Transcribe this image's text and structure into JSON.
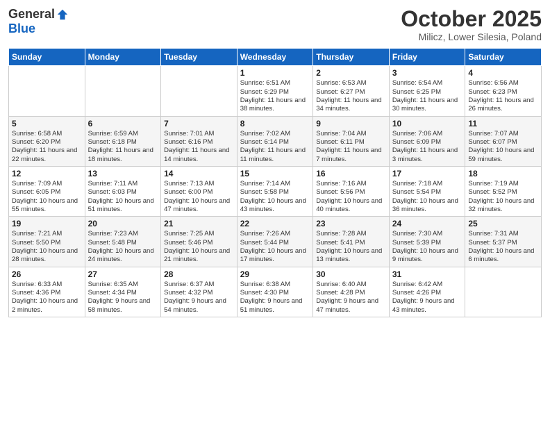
{
  "header": {
    "logo_general": "General",
    "logo_blue": "Blue",
    "month_title": "October 2025",
    "subtitle": "Milicz, Lower Silesia, Poland"
  },
  "days_of_week": [
    "Sunday",
    "Monday",
    "Tuesday",
    "Wednesday",
    "Thursday",
    "Friday",
    "Saturday"
  ],
  "weeks": [
    [
      {
        "day": "",
        "detail": ""
      },
      {
        "day": "",
        "detail": ""
      },
      {
        "day": "",
        "detail": ""
      },
      {
        "day": "1",
        "detail": "Sunrise: 6:51 AM\nSunset: 6:29 PM\nDaylight: 11 hours\nand 38 minutes."
      },
      {
        "day": "2",
        "detail": "Sunrise: 6:53 AM\nSunset: 6:27 PM\nDaylight: 11 hours\nand 34 minutes."
      },
      {
        "day": "3",
        "detail": "Sunrise: 6:54 AM\nSunset: 6:25 PM\nDaylight: 11 hours\nand 30 minutes."
      },
      {
        "day": "4",
        "detail": "Sunrise: 6:56 AM\nSunset: 6:23 PM\nDaylight: 11 hours\nand 26 minutes."
      }
    ],
    [
      {
        "day": "5",
        "detail": "Sunrise: 6:58 AM\nSunset: 6:20 PM\nDaylight: 11 hours\nand 22 minutes."
      },
      {
        "day": "6",
        "detail": "Sunrise: 6:59 AM\nSunset: 6:18 PM\nDaylight: 11 hours\nand 18 minutes."
      },
      {
        "day": "7",
        "detail": "Sunrise: 7:01 AM\nSunset: 6:16 PM\nDaylight: 11 hours\nand 14 minutes."
      },
      {
        "day": "8",
        "detail": "Sunrise: 7:02 AM\nSunset: 6:14 PM\nDaylight: 11 hours\nand 11 minutes."
      },
      {
        "day": "9",
        "detail": "Sunrise: 7:04 AM\nSunset: 6:11 PM\nDaylight: 11 hours\nand 7 minutes."
      },
      {
        "day": "10",
        "detail": "Sunrise: 7:06 AM\nSunset: 6:09 PM\nDaylight: 11 hours\nand 3 minutes."
      },
      {
        "day": "11",
        "detail": "Sunrise: 7:07 AM\nSunset: 6:07 PM\nDaylight: 10 hours\nand 59 minutes."
      }
    ],
    [
      {
        "day": "12",
        "detail": "Sunrise: 7:09 AM\nSunset: 6:05 PM\nDaylight: 10 hours\nand 55 minutes."
      },
      {
        "day": "13",
        "detail": "Sunrise: 7:11 AM\nSunset: 6:03 PM\nDaylight: 10 hours\nand 51 minutes."
      },
      {
        "day": "14",
        "detail": "Sunrise: 7:13 AM\nSunset: 6:00 PM\nDaylight: 10 hours\nand 47 minutes."
      },
      {
        "day": "15",
        "detail": "Sunrise: 7:14 AM\nSunset: 5:58 PM\nDaylight: 10 hours\nand 43 minutes."
      },
      {
        "day": "16",
        "detail": "Sunrise: 7:16 AM\nSunset: 5:56 PM\nDaylight: 10 hours\nand 40 minutes."
      },
      {
        "day": "17",
        "detail": "Sunrise: 7:18 AM\nSunset: 5:54 PM\nDaylight: 10 hours\nand 36 minutes."
      },
      {
        "day": "18",
        "detail": "Sunrise: 7:19 AM\nSunset: 5:52 PM\nDaylight: 10 hours\nand 32 minutes."
      }
    ],
    [
      {
        "day": "19",
        "detail": "Sunrise: 7:21 AM\nSunset: 5:50 PM\nDaylight: 10 hours\nand 28 minutes."
      },
      {
        "day": "20",
        "detail": "Sunrise: 7:23 AM\nSunset: 5:48 PM\nDaylight: 10 hours\nand 24 minutes."
      },
      {
        "day": "21",
        "detail": "Sunrise: 7:25 AM\nSunset: 5:46 PM\nDaylight: 10 hours\nand 21 minutes."
      },
      {
        "day": "22",
        "detail": "Sunrise: 7:26 AM\nSunset: 5:44 PM\nDaylight: 10 hours\nand 17 minutes."
      },
      {
        "day": "23",
        "detail": "Sunrise: 7:28 AM\nSunset: 5:41 PM\nDaylight: 10 hours\nand 13 minutes."
      },
      {
        "day": "24",
        "detail": "Sunrise: 7:30 AM\nSunset: 5:39 PM\nDaylight: 10 hours\nand 9 minutes."
      },
      {
        "day": "25",
        "detail": "Sunrise: 7:31 AM\nSunset: 5:37 PM\nDaylight: 10 hours\nand 6 minutes."
      }
    ],
    [
      {
        "day": "26",
        "detail": "Sunrise: 6:33 AM\nSunset: 4:36 PM\nDaylight: 10 hours\nand 2 minutes."
      },
      {
        "day": "27",
        "detail": "Sunrise: 6:35 AM\nSunset: 4:34 PM\nDaylight: 9 hours\nand 58 minutes."
      },
      {
        "day": "28",
        "detail": "Sunrise: 6:37 AM\nSunset: 4:32 PM\nDaylight: 9 hours\nand 54 minutes."
      },
      {
        "day": "29",
        "detail": "Sunrise: 6:38 AM\nSunset: 4:30 PM\nDaylight: 9 hours\nand 51 minutes."
      },
      {
        "day": "30",
        "detail": "Sunrise: 6:40 AM\nSunset: 4:28 PM\nDaylight: 9 hours\nand 47 minutes."
      },
      {
        "day": "31",
        "detail": "Sunrise: 6:42 AM\nSunset: 4:26 PM\nDaylight: 9 hours\nand 43 minutes."
      },
      {
        "day": "",
        "detail": ""
      }
    ]
  ]
}
